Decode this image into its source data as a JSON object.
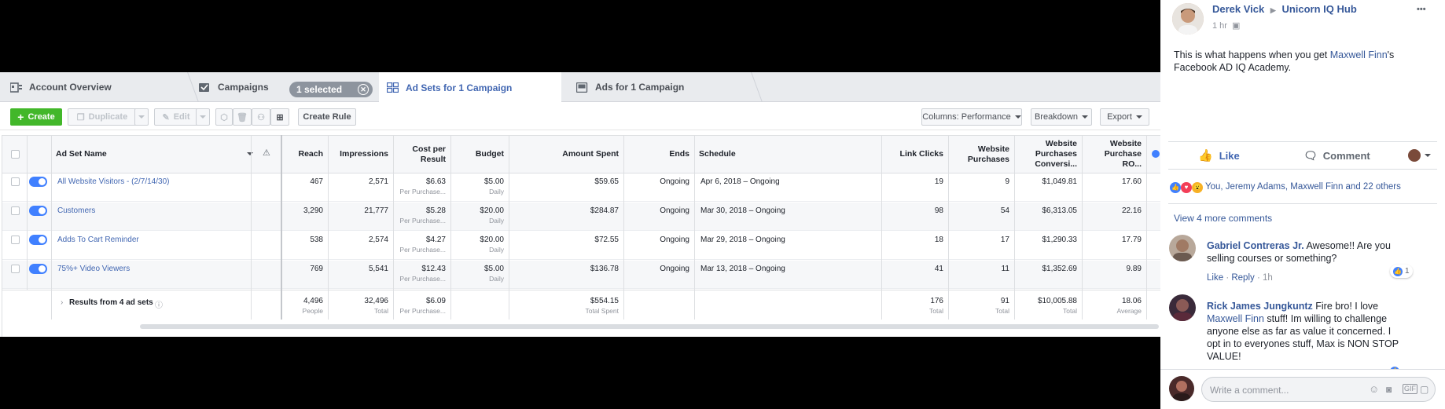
{
  "tabs": {
    "account_overview": "Account Overview",
    "campaigns": "Campaigns",
    "selected_pill": "1 selected",
    "ad_sets": "Ad Sets for 1 Campaign",
    "ads": "Ads for 1 Campaign"
  },
  "toolbar": {
    "create": "Create",
    "duplicate": "Duplicate",
    "edit": "Edit",
    "create_rule": "Create Rule",
    "columns": "Columns: Performance",
    "breakdown": "Breakdown",
    "export": "Export"
  },
  "table": {
    "headers": {
      "name": "Ad Set Name",
      "reach": "Reach",
      "impressions": "Impressions",
      "cost_per_result": "Cost per Result",
      "budget": "Budget",
      "amount_spent": "Amount Spent",
      "ends": "Ends",
      "schedule": "Schedule",
      "link_clicks": "Link Clicks",
      "website_purchases": "Website Purchases",
      "website_purchases_conv": "Website Purchases Conversi...",
      "website_purchase_roas": "Website Purchase RO..."
    },
    "rows": [
      {
        "name": "All Website Visitors - (2/7/14/30)",
        "reach": "467",
        "impressions": "2,571",
        "cpr": "$6.63",
        "cpr_sub": "Per Purchase...",
        "budget": "$5.00",
        "budget_sub": "Daily",
        "spent": "$59.65",
        "ends": "Ongoing",
        "schedule": "Apr 6, 2018 – Ongoing",
        "clicks": "19",
        "purchases": "9",
        "conv": "$1,049.81",
        "roas": "17.60"
      },
      {
        "name": "Customers",
        "reach": "3,290",
        "impressions": "21,777",
        "cpr": "$5.28",
        "cpr_sub": "Per Purchase...",
        "budget": "$20.00",
        "budget_sub": "Daily",
        "spent": "$284.87",
        "ends": "Ongoing",
        "schedule": "Mar 30, 2018 – Ongoing",
        "clicks": "98",
        "purchases": "54",
        "conv": "$6,313.05",
        "roas": "22.16"
      },
      {
        "name": "Adds To Cart Reminder",
        "reach": "538",
        "impressions": "2,574",
        "cpr": "$4.27",
        "cpr_sub": "Per Purchase...",
        "budget": "$20.00",
        "budget_sub": "Daily",
        "spent": "$72.55",
        "ends": "Ongoing",
        "schedule": "Mar 29, 2018 – Ongoing",
        "clicks": "18",
        "purchases": "17",
        "conv": "$1,290.33",
        "roas": "17.79"
      },
      {
        "name": "75%+ Video Viewers",
        "reach": "769",
        "impressions": "5,541",
        "cpr": "$12.43",
        "cpr_sub": "Per Purchase...",
        "budget": "$5.00",
        "budget_sub": "Daily",
        "spent": "$136.78",
        "ends": "Ongoing",
        "schedule": "Mar 13, 2018 – Ongoing",
        "clicks": "41",
        "purchases": "11",
        "conv": "$1,352.69",
        "roas": "9.89"
      }
    ],
    "totals": {
      "label": "Results from 4 ad sets",
      "reach": "4,496",
      "reach_sub": "People",
      "impressions": "32,496",
      "impressions_sub": "Total",
      "cpr": "$6.09",
      "cpr_sub": "Per Purchase...",
      "spent": "$554.15",
      "spent_sub": "Total Spent",
      "clicks": "176",
      "clicks_sub": "Total",
      "purchases": "91",
      "purchases_sub": "Total",
      "conv": "$10,005.88",
      "conv_sub": "Total",
      "roas": "18.06",
      "roas_sub": "Average"
    }
  },
  "post": {
    "author": "Derek Vick",
    "group": "Unicorn IQ Hub",
    "time": "1 hr",
    "more": "•••",
    "text_before": "This is what happens when you get ",
    "text_link": "Maxwell Finn",
    "text_after": "'s Facebook AD IQ Academy.",
    "like": "Like",
    "comment": "Comment",
    "reactions": "You, Jeremy Adams, Maxwell Finn and 22 others",
    "view_more": "View 4 more comments",
    "comments": [
      {
        "author": "Gabriel Contreras Jr.",
        "text": "Awesome!! Are you selling courses or something?",
        "like": "Like",
        "reply": "Reply",
        "time": "1h",
        "likes": "1"
      },
      {
        "author": "Rick James Jungkuntz",
        "text_before": "Fire bro! I love ",
        "text_link": "Maxwell Finn",
        "text_after": " stuff! Im willing to challenge anyone else as far as value it concerned. I opt in to everyones stuff, Max is NON STOP VALUE!"
      }
    ],
    "compose_placeholder": "Write a comment..."
  }
}
